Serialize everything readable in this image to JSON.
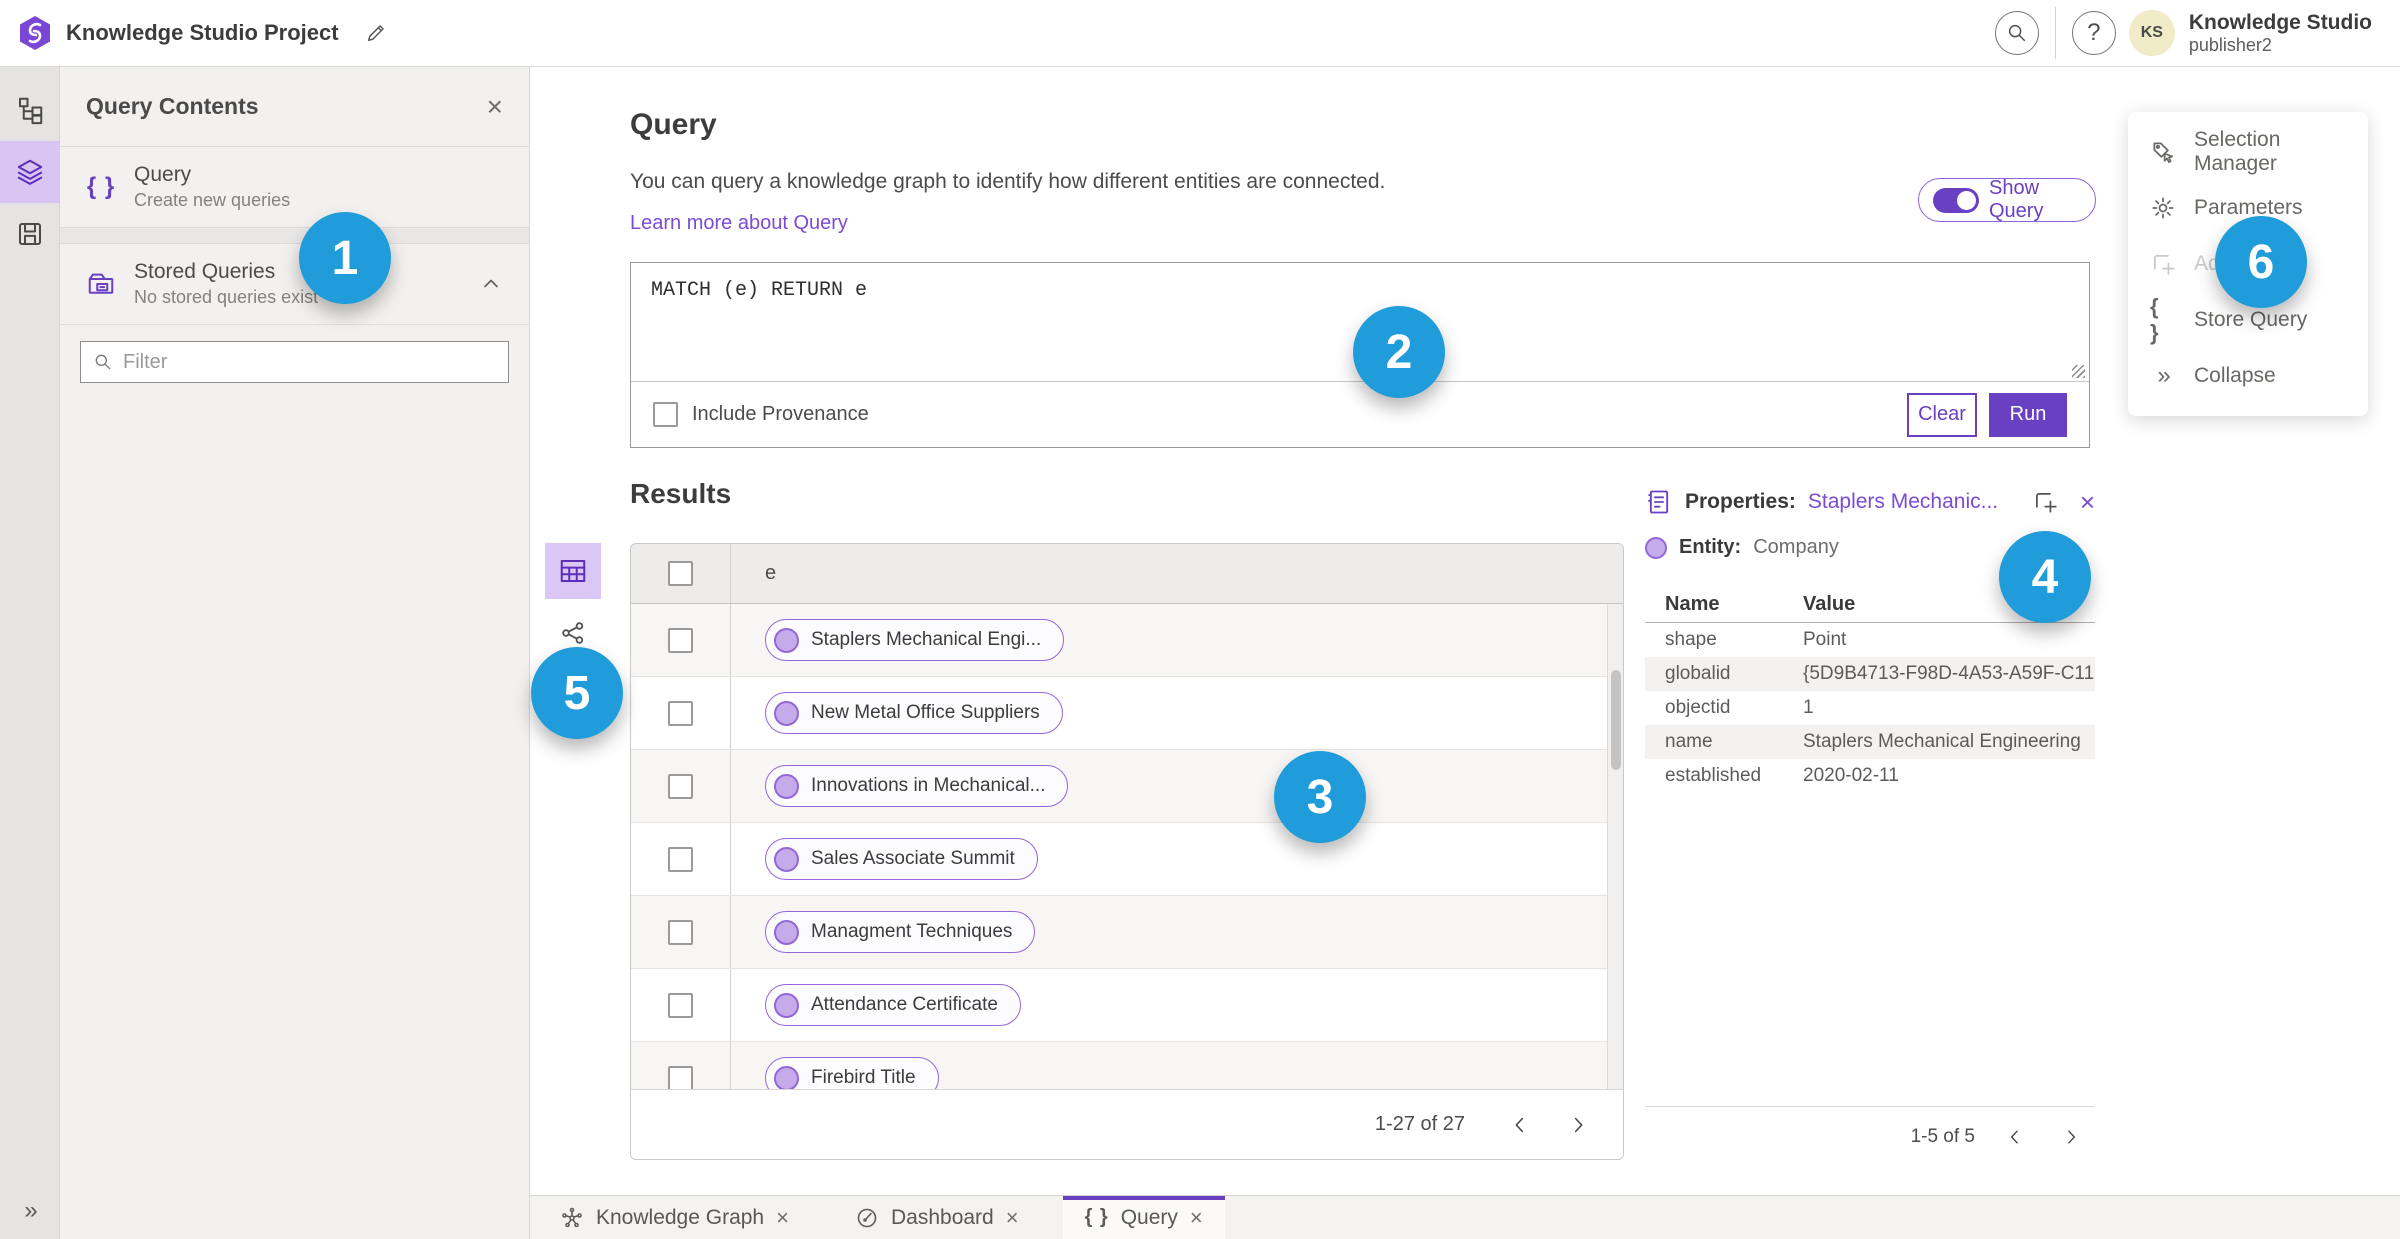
{
  "colors": {
    "accent_purple": "#6a40c2",
    "chip_border": "#9268d8",
    "badge_blue": "#1f9cd9",
    "avatar_bg": "#efecc7"
  },
  "topbar": {
    "title": "Knowledge Studio Project",
    "avatar_initials": "KS",
    "user_name": "Knowledge Studio",
    "user_role": "publisher2"
  },
  "icons": {
    "close": "×",
    "help": "?",
    "braces": "{ }",
    "collapse": "»"
  },
  "contents_panel": {
    "title": "Query Contents",
    "items": [
      {
        "label": "Query",
        "sub": "Create new queries"
      },
      {
        "label": "Stored Queries",
        "sub": "No stored queries exist"
      }
    ],
    "filter_placeholder": "Filter"
  },
  "query_section": {
    "heading": "Query",
    "description": "You can query a knowledge graph to identify how different entities are connected.",
    "learn_link": "Learn more about Query",
    "show_query_label": "Show Query",
    "query_text": "MATCH (e) RETURN e",
    "include_provenance_label": "Include Provenance",
    "clear_label": "Clear",
    "run_label": "Run"
  },
  "results": {
    "heading": "Results",
    "column_header": "e",
    "rows": [
      {
        "label": "Staplers Mechanical Engi..."
      },
      {
        "label": "New Metal Office Suppliers"
      },
      {
        "label": "Innovations in Mechanical..."
      },
      {
        "label": "Sales Associate Summit"
      },
      {
        "label": "Managment Techniques"
      },
      {
        "label": "Attendance Certificate"
      },
      {
        "label": "Firebird Title"
      }
    ],
    "pagination": "1-27 of 27"
  },
  "properties_panel": {
    "title_prefix": "Properties:",
    "title_link": "Staplers Mechanic...",
    "entity_prefix": "Entity:",
    "entity_value": "Company",
    "col_name": "Name",
    "col_value": "Value",
    "rows": [
      {
        "name": "shape",
        "value": "Point"
      },
      {
        "name": "globalid",
        "value": "{5D9B4713-F98D-4A53-A59F-C11..."
      },
      {
        "name": "objectid",
        "value": "1"
      },
      {
        "name": "name",
        "value": "Staplers Mechanical Engineering"
      },
      {
        "name": "established",
        "value": "2020-02-11"
      }
    ],
    "pagination": "1-5 of 5"
  },
  "right_menu": {
    "items": [
      {
        "label": "Selection Manager"
      },
      {
        "label": "Parameters"
      },
      {
        "label": "Ad"
      },
      {
        "label": "Store Query"
      },
      {
        "label": "Collapse"
      }
    ]
  },
  "tabs": [
    {
      "label": "Knowledge Graph"
    },
    {
      "label": "Dashboard"
    },
    {
      "label": "Query"
    }
  ],
  "badges": [
    "1",
    "2",
    "3",
    "4",
    "5",
    "6"
  ]
}
